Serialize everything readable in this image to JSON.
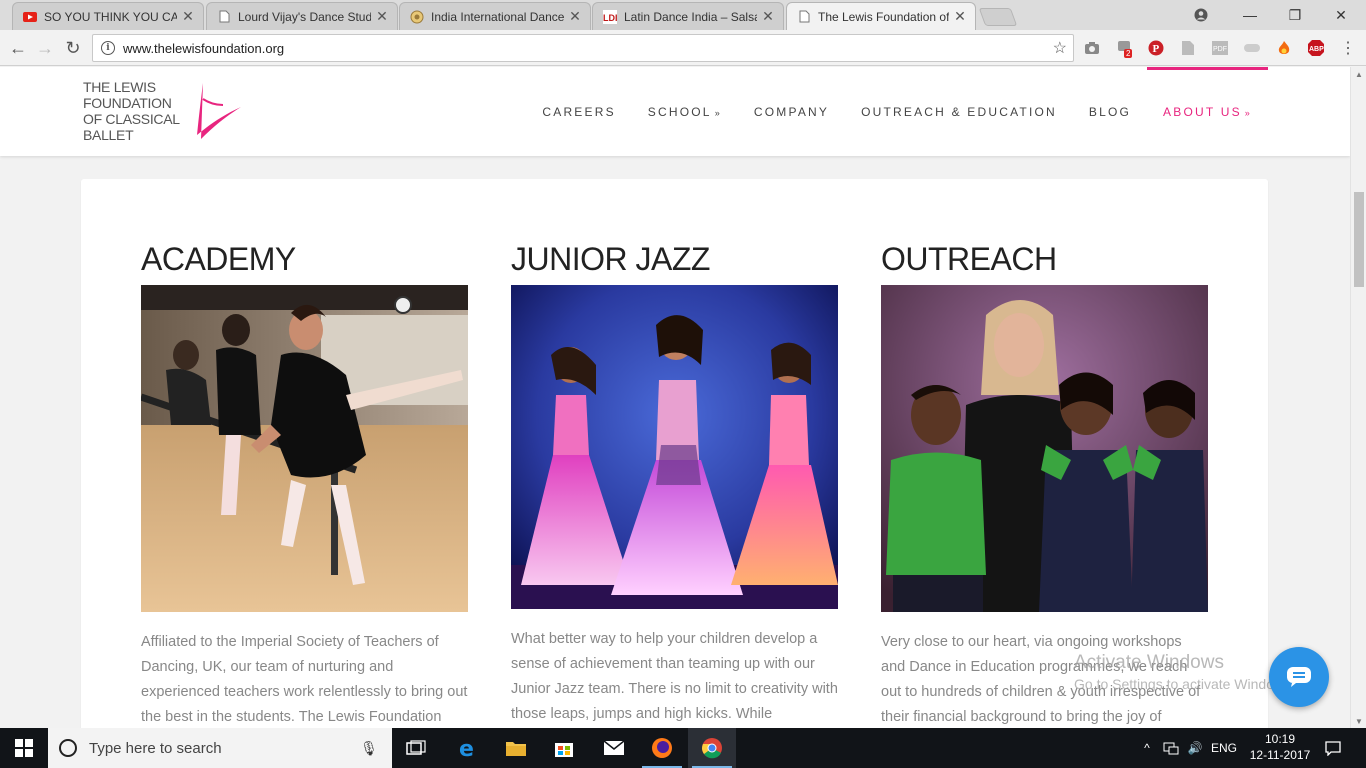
{
  "browser": {
    "tabs": [
      {
        "title": "SO YOU THINK YOU CAN",
        "favicon": "youtube-icon",
        "active": false
      },
      {
        "title": "Lourd Vijay's Dance Stud",
        "favicon": "page-icon",
        "active": false
      },
      {
        "title": "India International Dance",
        "favicon": "globe-icon",
        "active": false
      },
      {
        "title": "Latin Dance India – Salsa",
        "favicon": "ldi-icon",
        "active": false
      },
      {
        "title": "The Lewis Foundation of",
        "favicon": "page-icon",
        "active": true
      }
    ],
    "url": "www.thelewisfoundation.org",
    "extension_badge": "2",
    "extensions": [
      "camera-icon",
      "extension-icon",
      "pinterest-icon",
      "pdf-icon",
      "pdf-icon",
      "toggle-icon",
      "fire-icon",
      "abp-icon",
      "menu-icon"
    ],
    "accent": "#e8257f"
  },
  "site": {
    "logo_lines": [
      "THE LEWIS",
      "FOUNDATION",
      "OF CLASSICAL",
      "BALLET"
    ],
    "nav": [
      {
        "label": "CAREERS",
        "dropdown": false,
        "active": false
      },
      {
        "label": "SCHOOL",
        "dropdown": true,
        "active": false
      },
      {
        "label": "COMPANY",
        "dropdown": false,
        "active": false
      },
      {
        "label": "OUTREACH & EDUCATION",
        "dropdown": false,
        "active": false
      },
      {
        "label": "BLOG",
        "dropdown": false,
        "active": false
      },
      {
        "label": "ABOUT US",
        "dropdown": true,
        "active": true
      }
    ],
    "sections": [
      {
        "heading": "ACADEMY",
        "text": "Affiliated to the Imperial Society of Teachers of Dancing, UK, our team of nurturing and experienced teachers work relentlessly to bring out the best in the students. The Lewis Foundation"
      },
      {
        "heading": "JUNIOR JAZZ",
        "text": "What better way to help your children develop a sense of achievement than teaming up with our Junior Jazz team. There is no limit to creativity with those leaps, jumps and high kicks. While"
      },
      {
        "heading": "OUTREACH",
        "text": "Very close to our heart, via ongoing workshops and Dance in Education programmes, we reach out to hundreds of children & youth irrespective of their financial background to bring the joy of"
      }
    ]
  },
  "watermark": {
    "title": "Activate Windows",
    "subtitle": "Go to Settings to activate Windows."
  },
  "taskbar": {
    "search_placeholder": "Type here to search",
    "language": "ENG",
    "time": "10:19",
    "date": "12-11-2017"
  }
}
